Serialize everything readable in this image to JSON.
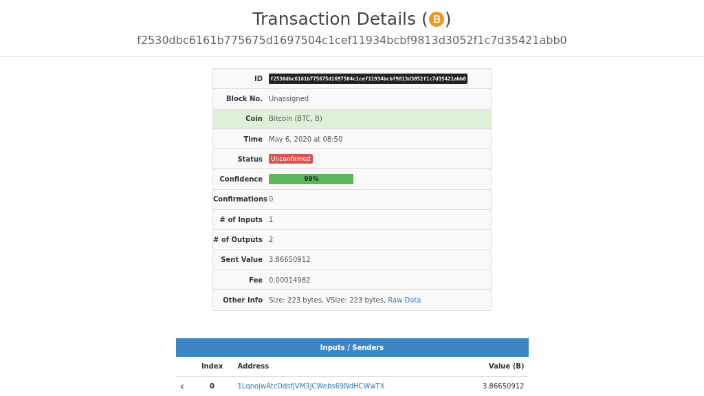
{
  "header": {
    "title_before": "Transaction Details (",
    "title_after": ")",
    "hash": "f2530dbc6161b775675d1697504c1cef11934bcbf9813d3052f1c7d35421abb0"
  },
  "details": [
    {
      "label": "ID",
      "kind": "code",
      "value": "f2530dbc6161b775675d1697504c1cef11934bcbf9813d3052f1c7d35421abb0",
      "highlighted": false
    },
    {
      "label": "Block No.",
      "kind": "text",
      "value": "Unassigned",
      "highlighted": false
    },
    {
      "label": "Coin",
      "kind": "text",
      "value": "Bitcoin (BTC, B)",
      "highlighted": true
    },
    {
      "label": "Time",
      "kind": "text",
      "value": "May 6, 2020 at 08:50",
      "highlighted": false
    },
    {
      "label": "Status",
      "kind": "badge",
      "value": "Unconfirmed",
      "highlighted": false
    },
    {
      "label": "Confidence",
      "kind": "progress",
      "value": "99%",
      "level": 0.99,
      "highlighted": false
    },
    {
      "label": "Confirmations",
      "kind": "text",
      "value": "0",
      "highlighted": false
    },
    {
      "label": "# of Inputs",
      "kind": "text",
      "value": "1",
      "highlighted": false
    },
    {
      "label": "# of Outputs",
      "kind": "text",
      "value": "2",
      "highlighted": false
    },
    {
      "label": "Sent Value",
      "kind": "text",
      "value": "3.86650912",
      "highlighted": false
    },
    {
      "label": "Fee",
      "kind": "text",
      "value": "0.00014982",
      "highlighted": false
    },
    {
      "label": "Other Info",
      "kind": "link",
      "value": "Size: 223 bytes, VSize: 223 bytes, ",
      "link": "Raw Data",
      "highlighted": false
    }
  ],
  "inputs": {
    "title": "Inputs / Senders",
    "columns": [
      "Index",
      "Address",
      "Value (B)"
    ],
    "rows": [
      {
        "icon": "‹",
        "index": "0",
        "address": "1LqnojwAtcDdsfjVM3jCWebs69NdHCWwTX",
        "value": "3.86650912"
      }
    ]
  }
}
